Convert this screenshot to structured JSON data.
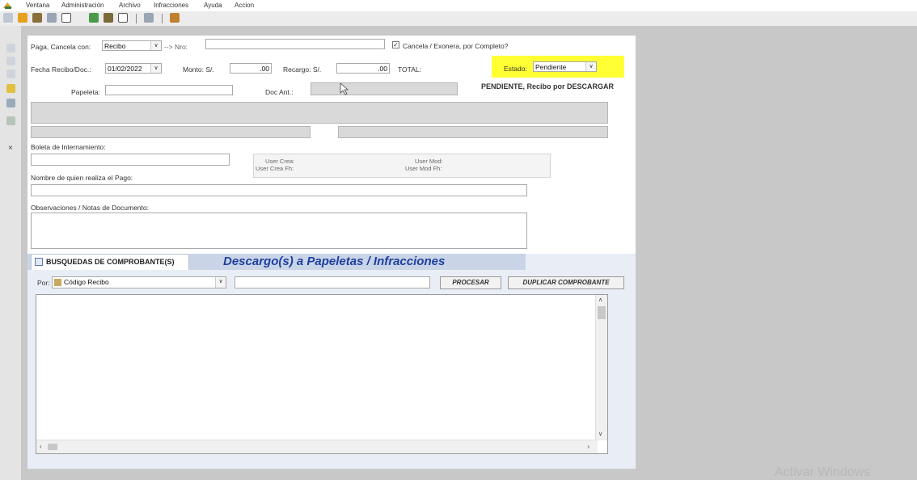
{
  "menu": {
    "items": [
      "Ventana",
      "Administración",
      "Archivo",
      "Infracciones",
      "Ayuda",
      "Accion"
    ]
  },
  "form": {
    "paga_label": "Paga, Cancela con:",
    "paga_value": "Recibo",
    "nro_label": "--> Nro:",
    "nro_value": "",
    "cancela_label": "Cancela / Exonera,  por Completo?",
    "cancela_checked": true,
    "fecha_label": "Fecha Recibo/Doc.:",
    "fecha_value": "01/02/2022",
    "monto_label": "Monto: S/.",
    "monto_value": ".00",
    "recargo_label": "Recargo: S/.",
    "recargo_value": ".00",
    "total_label": "TOTAL:",
    "estado_label": "Estado:",
    "estado_value": "Pendiente",
    "papeleta_label": "Papeleta:",
    "papeleta_value": "",
    "docant_label": "Doc Ant.:",
    "pendiente_text": "PENDIENTE, Recibo por DESCARGAR",
    "boleta_label": "Boleta de Internamiento:",
    "boleta_value": "",
    "user_crea_label": "User Crea:",
    "user_crea_fh_label": "User Crea Fh:",
    "user_mod_label": "User Mod:",
    "user_mod_fh_label": "User Mod Fh:",
    "nombre_label": "Nombre de quien realiza el Pago:",
    "nombre_value": "",
    "obs_label": "Observaciones / Notas de Documento:",
    "obs_value": ""
  },
  "panel": {
    "tab_label": "BUSQUEDAS DE COMPROBANTE(S)",
    "title": "Descargo(s) a Papeletas / Infracciones",
    "por_label": "Por:",
    "por_value": "Código Recibo",
    "search_value": "",
    "procesar_label": "PROCESAR",
    "duplicar_label": "DUPLICAR COMPROBANTE"
  },
  "watermark": "Activar Windows",
  "colors": {
    "estado_highlight": "#ffff33",
    "title_blue": "#1f3f9f",
    "workspace_grey": "#c8c8c8"
  }
}
